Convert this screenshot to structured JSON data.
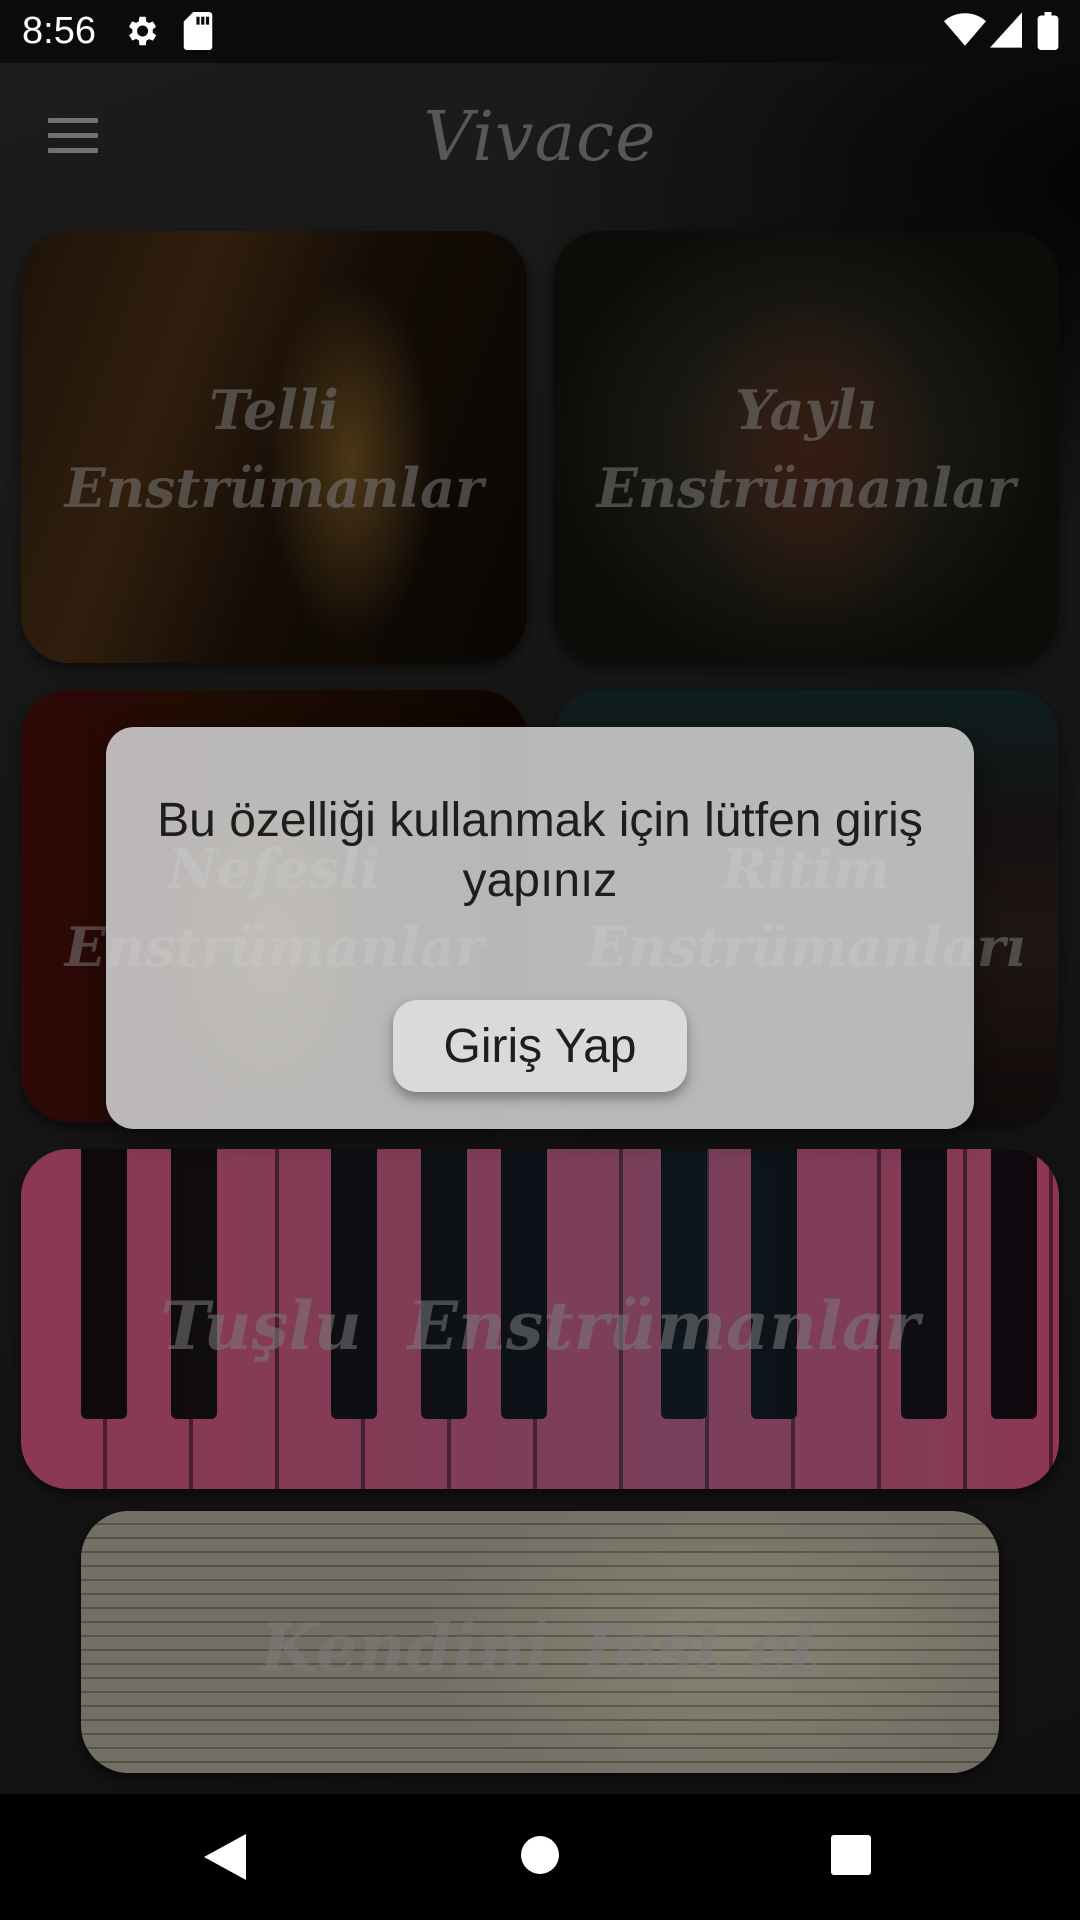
{
  "status_bar": {
    "time": "8:56",
    "icons": [
      "gear-icon",
      "sd-card-icon",
      "wifi-icon",
      "signal-icon",
      "battery-icon"
    ]
  },
  "app_bar": {
    "title": "Vivace",
    "menu_icon": "menu-icon"
  },
  "categories": [
    {
      "line1": "Telli",
      "line2": "Enstrümanlar"
    },
    {
      "line1": "Yaylı",
      "line2": "Enstrümanlar"
    },
    {
      "line1": "Nefesli",
      "line2": "Enstrümanlar"
    },
    {
      "line1": "Ritim",
      "line2": "Enstrümanları"
    },
    {
      "line1": "Tuşlu  Enstrümanlar"
    },
    {
      "line1": "Kendini Test et"
    }
  ],
  "dialog": {
    "message": "Bu özelliği kullanmak için lütfen giriş yapınız",
    "button_label": "Giriş Yap"
  },
  "nav_bar": {
    "icons": [
      "back-icon",
      "home-icon",
      "recents-icon"
    ]
  }
}
